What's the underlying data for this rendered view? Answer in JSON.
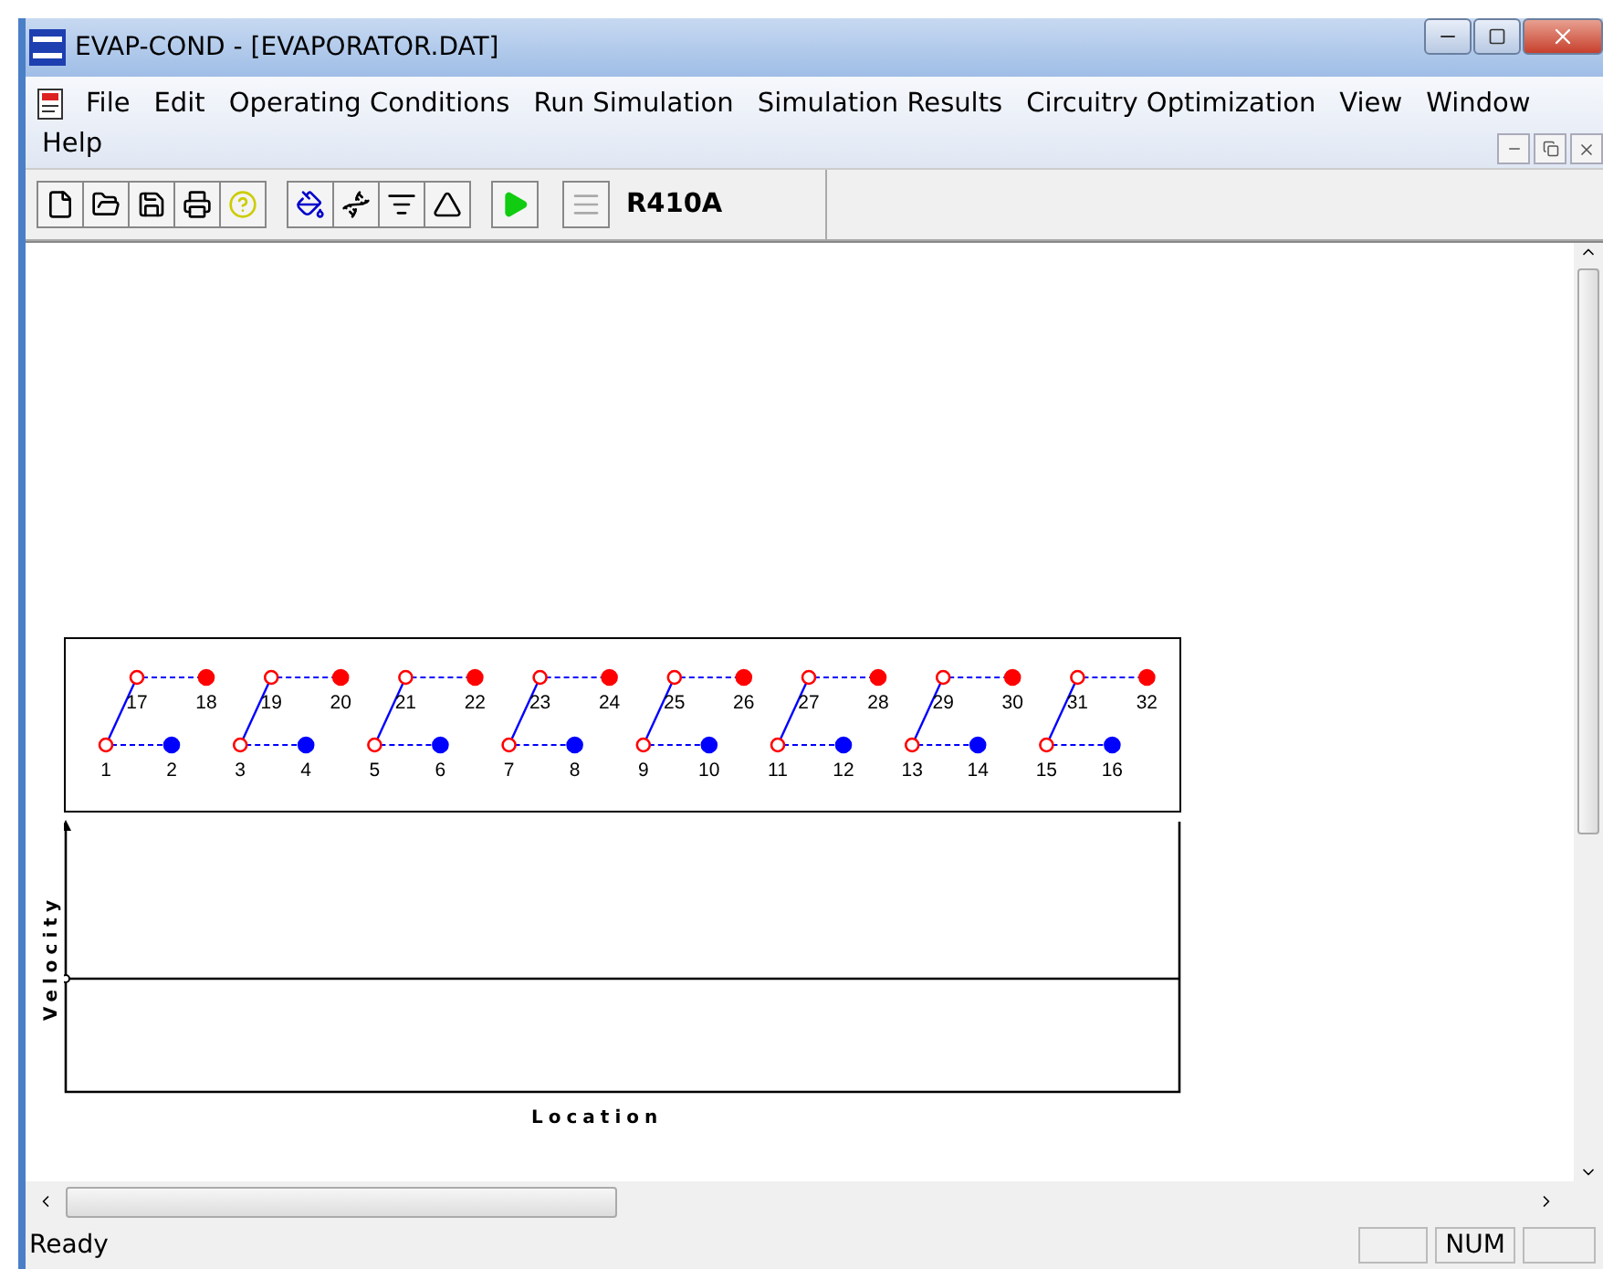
{
  "window": {
    "title": "EVAP-COND - [EVAPORATOR.DAT]"
  },
  "menu": [
    "File",
    "Edit",
    "Operating Conditions",
    "Run Simulation",
    "Simulation Results",
    "Circuitry Optimization",
    "View",
    "Window",
    "Help"
  ],
  "toolbar": {
    "buttons": [
      {
        "disabled": false
      },
      {
        "disabled": false
      },
      {
        "disabled": false
      },
      {
        "disabled": false
      },
      {
        "disabled": false
      },
      {
        "disabled": false
      },
      {
        "disabled": false
      },
      {
        "disabled": false
      },
      {
        "disabled": false
      },
      {
        "disabled": false
      },
      {
        "disabled": true
      }
    ],
    "refrigerant": "R410A"
  },
  "circuits": [
    {
      "tubes": [
        {
          "label": "1",
          "color": "#ff0000",
          "kind": "open"
        },
        {
          "label": "2",
          "color": "#0000ff",
          "kind": "filled"
        },
        {
          "label": "17",
          "color": "#ff0000",
          "kind": "open"
        },
        {
          "label": "18",
          "color": "#ff0000",
          "kind": "filled"
        }
      ]
    },
    {
      "tubes": [
        {
          "label": "3",
          "color": "#ff0000",
          "kind": "open"
        },
        {
          "label": "4",
          "color": "#0000ff",
          "kind": "filled"
        },
        {
          "label": "19",
          "color": "#ff0000",
          "kind": "open"
        },
        {
          "label": "20",
          "color": "#ff0000",
          "kind": "filled"
        }
      ]
    },
    {
      "tubes": [
        {
          "label": "5",
          "color": "#ff0000",
          "kind": "open"
        },
        {
          "label": "6",
          "color": "#0000ff",
          "kind": "filled"
        },
        {
          "label": "21",
          "color": "#ff0000",
          "kind": "open"
        },
        {
          "label": "22",
          "color": "#ff0000",
          "kind": "filled"
        }
      ]
    },
    {
      "tubes": [
        {
          "label": "7",
          "color": "#ff0000",
          "kind": "open"
        },
        {
          "label": "8",
          "color": "#0000ff",
          "kind": "filled"
        },
        {
          "label": "23",
          "color": "#ff0000",
          "kind": "open"
        },
        {
          "label": "24",
          "color": "#ff0000",
          "kind": "filled"
        }
      ]
    },
    {
      "tubes": [
        {
          "label": "9",
          "color": "#ff0000",
          "kind": "open"
        },
        {
          "label": "10",
          "color": "#0000ff",
          "kind": "filled"
        },
        {
          "label": "25",
          "color": "#ff0000",
          "kind": "open"
        },
        {
          "label": "26",
          "color": "#ff0000",
          "kind": "filled"
        }
      ]
    },
    {
      "tubes": [
        {
          "label": "11",
          "color": "#ff0000",
          "kind": "open"
        },
        {
          "label": "12",
          "color": "#0000ff",
          "kind": "filled"
        },
        {
          "label": "27",
          "color": "#ff0000",
          "kind": "open"
        },
        {
          "label": "28",
          "color": "#ff0000",
          "kind": "filled"
        }
      ]
    },
    {
      "tubes": [
        {
          "label": "13",
          "color": "#ff0000",
          "kind": "open"
        },
        {
          "label": "14",
          "color": "#0000ff",
          "kind": "filled"
        },
        {
          "label": "29",
          "color": "#ff0000",
          "kind": "open"
        },
        {
          "label": "30",
          "color": "#ff0000",
          "kind": "filled"
        }
      ]
    },
    {
      "tubes": [
        {
          "label": "15",
          "color": "#ff0000",
          "kind": "open"
        },
        {
          "label": "16",
          "color": "#0000ff",
          "kind": "filled"
        },
        {
          "label": "31",
          "color": "#ff0000",
          "kind": "open"
        },
        {
          "label": "32",
          "color": "#ff0000",
          "kind": "filled"
        }
      ]
    }
  ],
  "velocity_chart": {
    "ylabel": "Velocity",
    "xlabel": "Location"
  },
  "status_bar": {
    "text": "Ready",
    "indicators": [
      "NUM"
    ]
  }
}
